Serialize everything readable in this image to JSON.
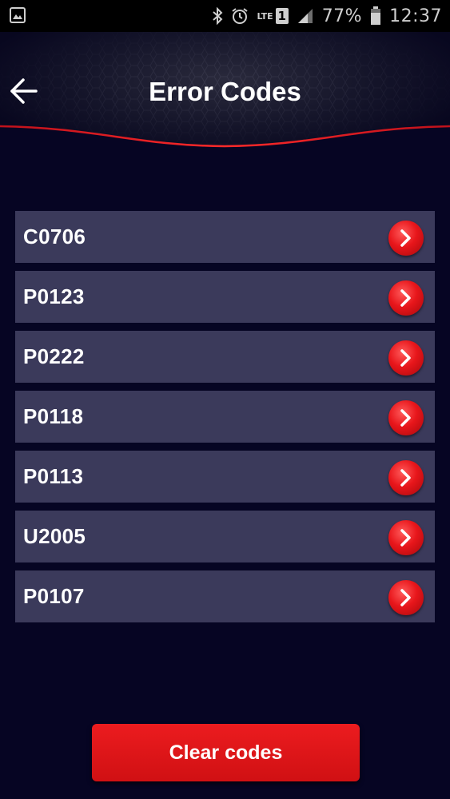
{
  "status_bar": {
    "battery": "77%",
    "time": "12:37",
    "network": "LTE",
    "sim_slot": "1",
    "icons": [
      "image-icon",
      "bluetooth-icon",
      "alarm-icon",
      "lte-icon",
      "signal-icon",
      "battery-icon"
    ]
  },
  "header": {
    "title": "Error Codes",
    "back_icon": "arrow-left-icon"
  },
  "codes": [
    {
      "code": "C0706"
    },
    {
      "code": "P0123"
    },
    {
      "code": "P0222"
    },
    {
      "code": "P0118"
    },
    {
      "code": "P0113"
    },
    {
      "code": "U2005"
    },
    {
      "code": "P0107"
    }
  ],
  "actions": {
    "clear_label": "Clear codes"
  },
  "colors": {
    "background": "#060523",
    "row": "#3b3a5b",
    "accent_red": "#e8161b",
    "header_line": "#d4121a"
  }
}
